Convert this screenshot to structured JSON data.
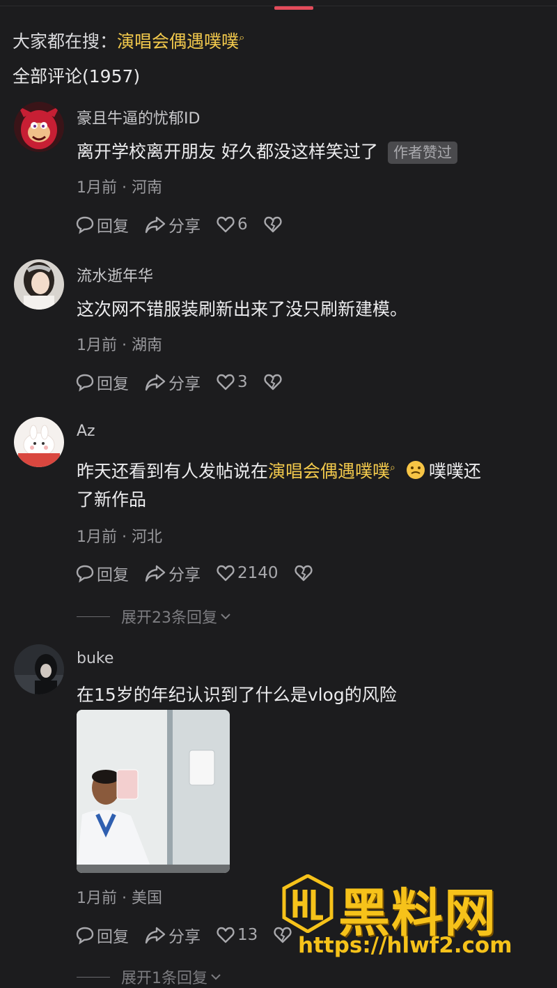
{
  "search": {
    "prefix": "大家都在搜：",
    "keyword": "演唱会偶遇噗噗"
  },
  "comments_header": "全部评论(1957)",
  "comments": [
    {
      "username": "豪且牛逼的忧郁ID",
      "text": "离开学校离开朋友  好久都没这样笑过了",
      "badge": "作者赞过",
      "time": "1月前",
      "location": "河南",
      "reply_label": "回复",
      "share_label": "分享",
      "likes": "6"
    },
    {
      "username": "流水逝年华",
      "text": "这次网不错服装刷新出来了没只刷新建模。",
      "time": "1月前",
      "location": "湖南",
      "reply_label": "回复",
      "share_label": "分享",
      "likes": "3"
    },
    {
      "username": "Az",
      "text_before": "昨天还看到有人发帖说在",
      "text_keyword": "演唱会偶遇噗噗",
      "text_after": "噗噗还",
      "text_line2": "了新作品",
      "time": "1月前",
      "location": "河北",
      "reply_label": "回复",
      "share_label": "分享",
      "likes": "2140",
      "expand_label": "展开23条回复"
    },
    {
      "username": "buke",
      "text": "在15岁的年纪认识到了什么是vlog的风险",
      "time": "1月前",
      "location": "美国",
      "reply_label": "回复",
      "share_label": "分享",
      "likes": "13",
      "expand_label": "展开1条回复"
    }
  ],
  "watermark": {
    "title": "黑料网",
    "url": "https://hlwf2.com"
  },
  "colors": {
    "background": "#1c1c1e",
    "keyword": "#f2c94c",
    "accent": "#e24b5a",
    "watermark": "#f6c21a"
  }
}
